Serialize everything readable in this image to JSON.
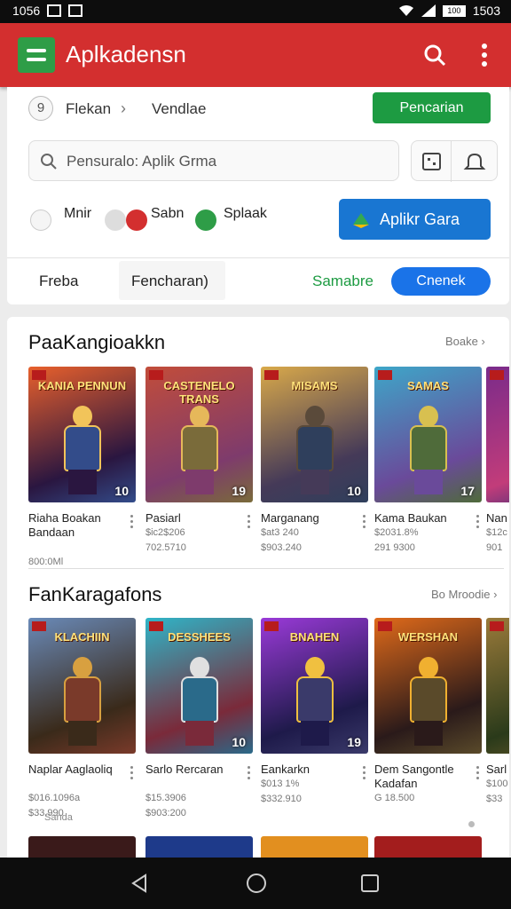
{
  "status": {
    "time_left": "1056",
    "time_right": "1503",
    "battery_label": "100"
  },
  "app": {
    "title": "Aplkadensn"
  },
  "breadcrumb": {
    "number": "9",
    "item1": "Flekan",
    "item2": "Vendlae"
  },
  "buttons": {
    "green": "Pencarian",
    "blue": "Aplikr Gara"
  },
  "search": {
    "placeholder": "Pensuralo: Aplik Grma"
  },
  "filters": {
    "chip1": "Mnir",
    "chip2": "Sabn",
    "chip3": "Splaak"
  },
  "tabs": {
    "t1": "Freba",
    "t2": "Fencharan)",
    "t3": "Samabre",
    "t4": "Cnenek"
  },
  "section1": {
    "title": "PaaKangioakkn",
    "more": "Boake",
    "items": [
      {
        "banner": "KANIA PENNUN",
        "rank": "10",
        "name": "Riaha Boakan Bandaan",
        "price1": "",
        "price2": "800:0Ml"
      },
      {
        "banner": "CASTENELO TRANS",
        "rank": "19",
        "name": "Pasiarl",
        "price1": "$ic2$206",
        "price2": "702.5710"
      },
      {
        "banner": "MISAMS",
        "rank": "10",
        "name": "Marganang",
        "price1": "$at3 240",
        "price2": "$903.240"
      },
      {
        "banner": "SAMAS",
        "rank": "17",
        "name": "Kama Baukan",
        "price1": "$2031.8%",
        "price2": "291 9300"
      },
      {
        "banner": "",
        "rank": "",
        "name": "Nan",
        "price1": "$12c",
        "price2": "901"
      }
    ]
  },
  "section2": {
    "title": "FanKaragafons",
    "more": "Bo Mroodie",
    "items": [
      {
        "banner": "KLACHIIN",
        "rank": "",
        "name": "Naplar Aaglaoliq",
        "price1": "$016.1096a",
        "price2": "$33.990"
      },
      {
        "banner": "DESSHEES",
        "rank": "10",
        "name": "Sarlo Rercaran",
        "price1": "$15.3906",
        "price2": "$903:200"
      },
      {
        "banner": "BNAHEN",
        "rank": "19",
        "name": "Eankarkn",
        "price1": "$013 1%",
        "price2": "$332.910"
      },
      {
        "banner": "WERSHAN",
        "rank": "",
        "name": "Dem Sangontle Kadafan",
        "price1": "G 18.500",
        "price2": ""
      },
      {
        "banner": "",
        "rank": "",
        "name": "Sarl",
        "price1": "$100",
        "price2": "$33"
      }
    ],
    "footer_label": "Sanda"
  },
  "colors": {
    "appbar": "#d32f2f",
    "green": "#1d9b42",
    "blue": "#1a73e8"
  }
}
